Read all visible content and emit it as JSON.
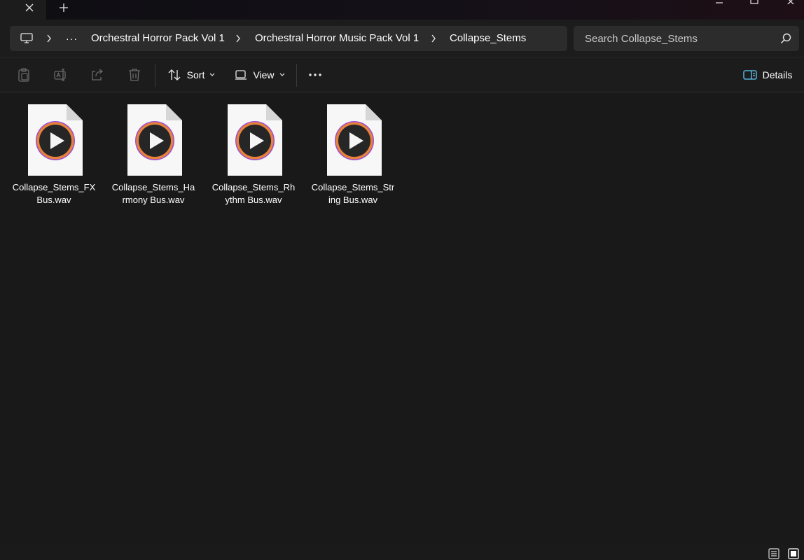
{
  "window": {
    "tab_close_icon": "close-icon",
    "new_tab_icon": "plus-icon"
  },
  "address": {
    "root_icon": "computer-icon",
    "overflow_label": "···",
    "crumbs": [
      "Orchestral Horror Pack Vol 1",
      "Orchestral Horror Music Pack Vol 1",
      "Collapse_Stems"
    ]
  },
  "search": {
    "placeholder": "Search Collapse_Stems"
  },
  "toolbar": {
    "sort_label": "Sort",
    "view_label": "View",
    "details_label": "Details"
  },
  "files": [
    {
      "name": "Collapse_Stems_FX Bus.wav"
    },
    {
      "name": "Collapse_Stems_Harmony Bus.wav"
    },
    {
      "name": "Collapse_Stems_Rhythm Bus.wav"
    },
    {
      "name": "Collapse_Stems_String Bus.wav"
    }
  ],
  "colors": {
    "background": "#191919",
    "bar": "#1c1c1c",
    "field": "#2c2c2c",
    "accent": "#60cdff"
  }
}
